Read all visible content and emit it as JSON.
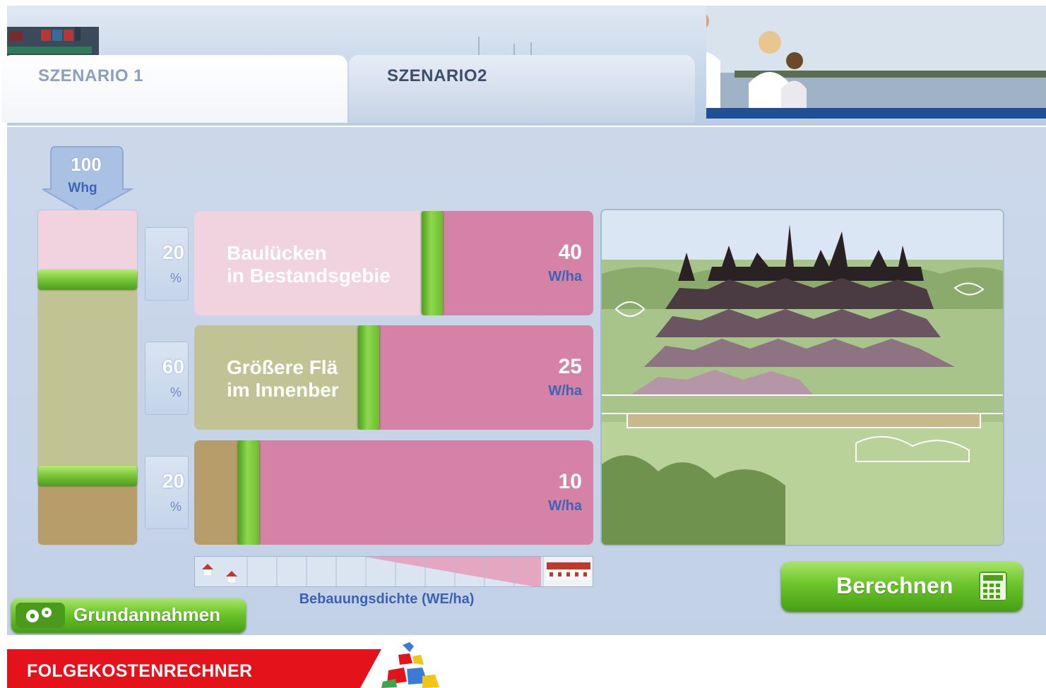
{
  "tabs": [
    {
      "label": "SZENARIO 1",
      "active": false
    },
    {
      "label": "SZENARIO2",
      "active": true
    }
  ],
  "total": {
    "value": "100",
    "unit": "Whg"
  },
  "rows": [
    {
      "percent": "20",
      "percent_sign": "%",
      "label_line1": "Baulücken",
      "label_line2": "in Bestandsgebie",
      "density": "40",
      "unit": "W/ha",
      "fill_color": "#f0d3de",
      "handle_fraction": 0.57
    },
    {
      "percent": "60",
      "percent_sign": "%",
      "label_line1": "Größere Flä",
      "label_line2": "im Innenber",
      "density": "25",
      "unit": "W/ha",
      "fill_color": "#c2c394",
      "handle_fraction": 0.41
    },
    {
      "percent": "20",
      "percent_sign": "%",
      "label_line1": "",
      "label_line2": "",
      "density": "10",
      "unit": "W/ha",
      "fill_color": "#b79d6a",
      "handle_fraction": 0.11
    }
  ],
  "scale_label": "Bebauungsdichte (WE/ha)",
  "buttons": {
    "calculate": "Berechnen",
    "assumptions": "Grundannahmen"
  },
  "footer": {
    "app_name": "FOLGEKOSTENRECHNER"
  },
  "colors": {
    "accent_green": "#6cc52b",
    "row_bg": "#d681a6",
    "footer_red": "#e3121b",
    "link_blue": "#3a62b7"
  }
}
